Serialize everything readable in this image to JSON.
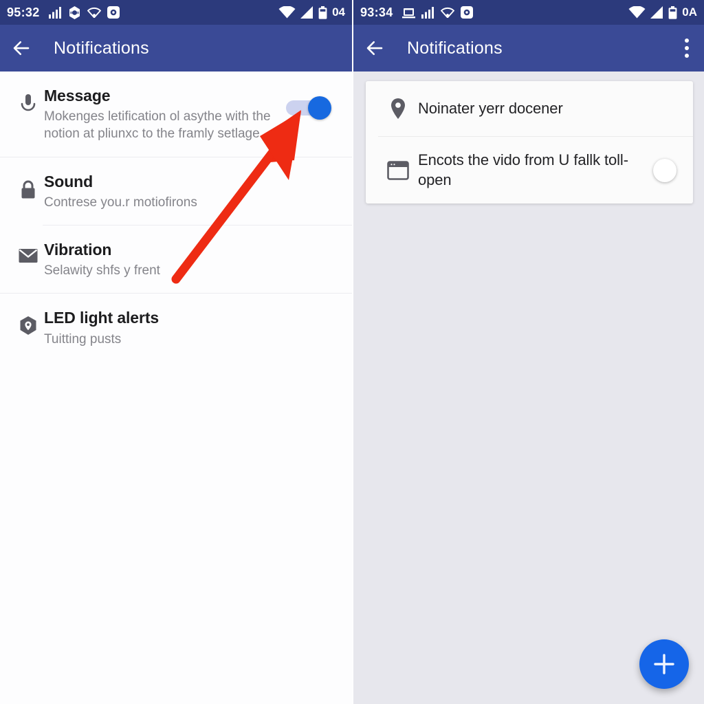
{
  "colors": {
    "statusbar": "#2c3a7c",
    "appbar": "#3a4a96",
    "accent_blue": "#1565e8",
    "toggle_on_thumb": "#1769e0",
    "toggle_on_track": "#ccd2ef",
    "annotation_red": "#ee2b13",
    "right_panel_bg": "#e7e7ed",
    "card_bg": "#fbfbfb",
    "title_text": "#1c1c1e",
    "subtitle_text": "#84848a"
  },
  "left_panel": {
    "statusbar": {
      "clock": "95:32",
      "battery_level": "04",
      "left_icons": [
        "signal-bars-icon",
        "sync-icon",
        "wifi-icon",
        "camera-icon"
      ],
      "right_icons": [
        "wifi-filled-icon",
        "signal-triangle-icon",
        "battery-icon"
      ]
    },
    "appbar": {
      "back_icon": "back-arrow-icon",
      "title": "Notifications"
    },
    "items": [
      {
        "icon": "microphone-icon",
        "title": "Message",
        "subtitle": "Mokenges letification ol asythe with the notion at pliunxc to the framly setlage",
        "toggle": "on"
      },
      {
        "icon": "lock-icon",
        "title": "Sound",
        "subtitle": "Contrese you.r motiofirons",
        "toggle": "none"
      },
      {
        "icon": "envelope-icon",
        "title": "Vibration",
        "subtitle": "Selawity shfs y frent",
        "toggle": "none"
      },
      {
        "icon": "location-pin-hex-icon",
        "title": "LED light alerts",
        "subtitle": "Tuitting pusts",
        "toggle": "none"
      }
    ]
  },
  "right_panel": {
    "statusbar": {
      "clock": "93:34",
      "battery_level": "0A",
      "left_icons": [
        "monitor-icon",
        "signal-bars-icon",
        "wifi-icon",
        "camera-icon"
      ],
      "right_icons": [
        "wifi-filled-icon",
        "signal-triangle-icon",
        "battery-icon"
      ]
    },
    "appbar": {
      "back_icon": "back-arrow-icon",
      "title": "Notifications",
      "overflow_icon": "overflow-menu-icon"
    },
    "card_items": [
      {
        "icon": "location-pin-icon",
        "text": "Noinater yerr docener",
        "toggle": "none"
      },
      {
        "icon": "window-icon",
        "text": "Encots the vido from U fallk toll-open",
        "toggle": "off"
      }
    ],
    "fab": {
      "icon": "plus-icon",
      "label": "+"
    }
  },
  "annotation": {
    "type": "arrow",
    "points_to": "message-toggle",
    "color": "#ee2b13"
  }
}
